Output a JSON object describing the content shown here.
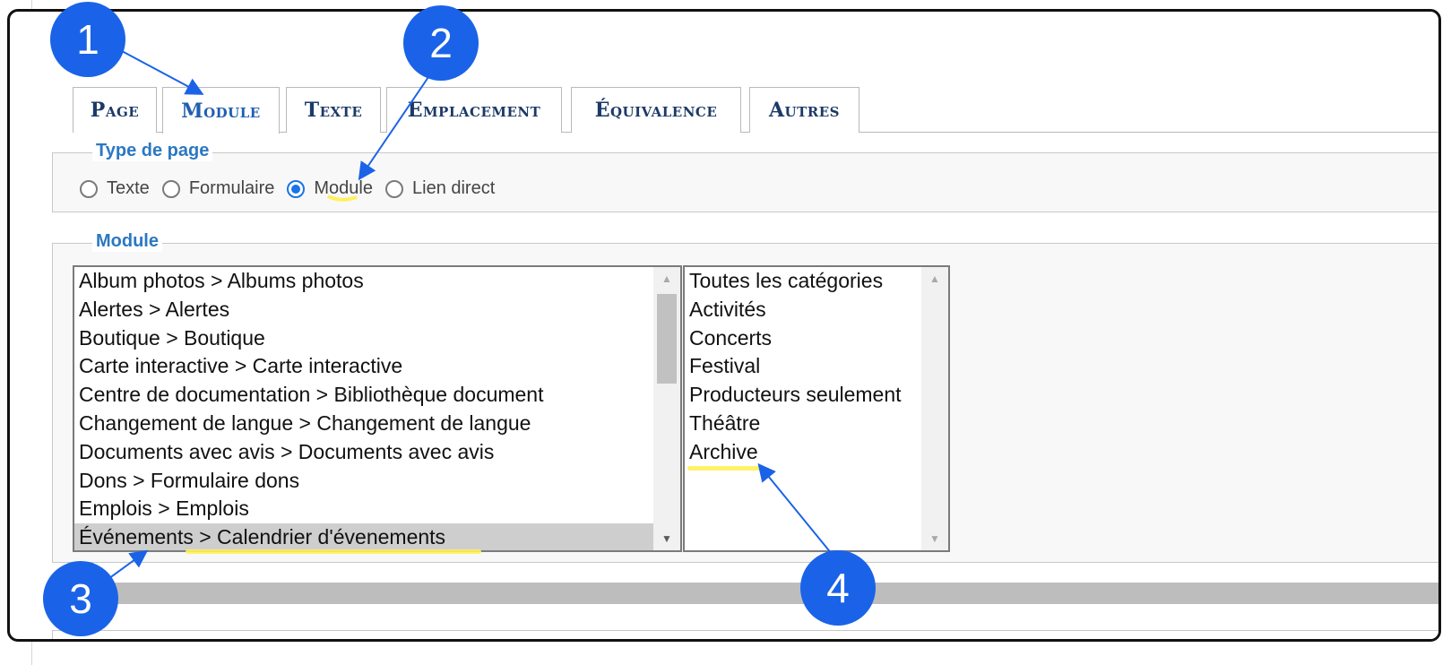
{
  "tabs": [
    {
      "label": "Page",
      "active": false
    },
    {
      "label": "Module",
      "active": true
    },
    {
      "label": "Texte",
      "active": false
    },
    {
      "label": "Emplacement",
      "active": false
    },
    {
      "label": "Équivalence",
      "active": false
    },
    {
      "label": "Autres",
      "active": false
    }
  ],
  "type_de_page": {
    "legend": "Type de page",
    "options": [
      "Texte",
      "Formulaire",
      "Module",
      "Lien direct"
    ],
    "selected": "Module"
  },
  "module": {
    "legend": "Module",
    "modules_list": [
      "Album photos > Albums photos",
      "Alertes > Alertes",
      "Boutique > Boutique",
      "Carte interactive > Carte interactive",
      "Centre de documentation > Bibliothèque document",
      "Changement de langue > Changement de langue",
      "Documents avec avis > Documents avec avis",
      "Dons > Formulaire dons",
      "Emplois > Emplois",
      "Événements > Calendrier d'évenements"
    ],
    "modules_selected": "Événements > Calendrier d'évenements",
    "categories_list": [
      "Toutes les catégories",
      "Activités",
      "Concerts",
      "Festival",
      "Producteurs seulement",
      "Théâtre",
      "Archive"
    ]
  },
  "annotations": [
    "1",
    "2",
    "3",
    "4"
  ],
  "colors": {
    "badge": "#1a63e8",
    "highlight": "#fff15a",
    "legend": "#2b78c2",
    "tab_text": "#1c3a67"
  }
}
